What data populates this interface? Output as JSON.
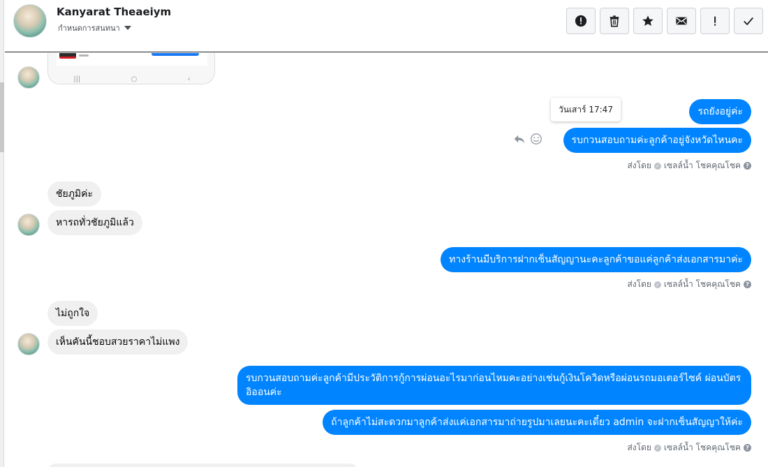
{
  "header": {
    "contact_name": "Kanyarat Theaeiym",
    "assign_label": "กำหนดการสนทนา",
    "actions": [
      {
        "name": "report-button",
        "icon": "exclamation-circle-icon"
      },
      {
        "name": "delete-button",
        "icon": "trash-icon"
      },
      {
        "name": "star-button",
        "icon": "star-icon"
      },
      {
        "name": "mark-unread-button",
        "icon": "envelope-icon"
      },
      {
        "name": "follow-up-button",
        "icon": "exclamation-icon"
      },
      {
        "name": "mark-done-button",
        "icon": "checkmark-icon"
      }
    ]
  },
  "tooltip": "วันเสาร์ 17:47",
  "messages": {
    "out_1": "รถยังอยู่ค่ะ",
    "out_2": "รบกวนสอบถามค่ะลูกค้าอยู่จังหวัดไหนคะ",
    "in_1": "ชัยภูมิค่ะ",
    "in_2": "หารถทั่วชัยภูมิแล้ว",
    "out_3": "ทางร้านมีบริการฝากเซ็นสัญญานะคะลูกค้าขอแค่ลูกค้าส่งเอกสารมาค่ะ",
    "in_3": "ไม่ถูกใจ",
    "in_4": "เห็นคันนี้ชอบสวยราคาไม่แพง",
    "out_4": "รบกวนสอบถามค่ะลูกค้ามีประวัติการกู้การผ่อนอะไรมาก่อนไหมคะอย่างเช่นกู้เงินโควิดหรือผ่อนรถมอเตอร์ไซค์ ผ่อนบัตรอิออนค่ะ",
    "out_5": "ถ้าลูกค้าไม่สะดวกมาลูกค้าส่งแค่เอกสารมาถ่ายรูปมาเลยนะคะเดี๋ยว admin จะฝากเซ็นสัญญาให้ค่ะ"
  },
  "sent_by": {
    "prefix": "ส่งโดย",
    "sender": "เซลล์น้ำ โชคคุณโชค"
  },
  "colors": {
    "outgoing_bubble": "#0084ff",
    "incoming_bubble": "#f0f0f0",
    "header_border": "#1c1e21"
  }
}
